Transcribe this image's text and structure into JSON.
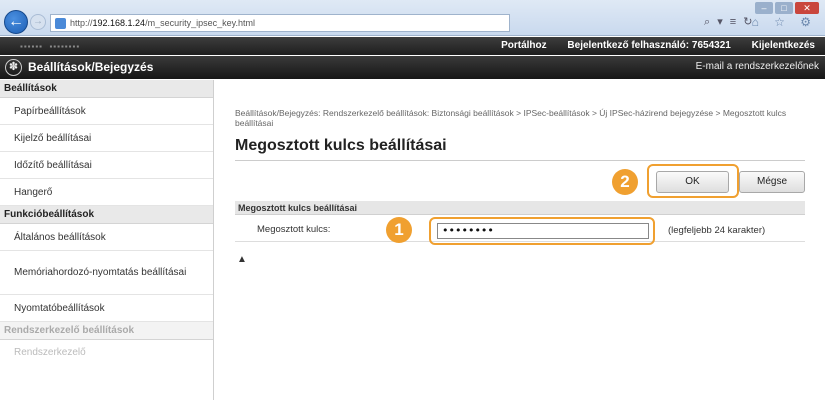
{
  "browser": {
    "url_prefix": "http://",
    "url_host": "192.168.1.24",
    "url_path": "/m_security_ipsec_key.html",
    "addr_tools": "⌕ ▾ ≡ ↻",
    "toolbar_icons": "⌂ ☆ ⚙",
    "window_controls": [
      "–",
      "□",
      "✕"
    ]
  },
  "header": {
    "links": [
      "Portálhoz",
      "Bejelentkező felhasználó: 7654321",
      "Kijelentkezés"
    ],
    "title": "Beállítások/Bejegyzés",
    "mail_link": "E-mail a rendszerkezelőnek"
  },
  "sidebar": {
    "section1": "Beállítások",
    "items1": [
      "Papírbeállítások",
      "Kijelző beállításai",
      "Időzítő beállításai",
      "Hangerő"
    ],
    "section2": "Funkcióbeállítások",
    "items2": [
      "Általános beállítások",
      "Memóriahordozó-nyomtatás beállításai",
      "Nyomtatóbeállítások"
    ],
    "section3": "Rendszerkezelő beállítások",
    "items3": [
      "Rendszerkezelő"
    ]
  },
  "main": {
    "breadcrumb": "Beállítások/Bejegyzés: Rendszerkezelő beállítások: Biztonsági beállítások > IPSec-beállítások > Új IPSec-házirend bejegyzése > Megosztott kulcs beállításai",
    "title": "Megosztott kulcs beállításai",
    "ok_label": "OK",
    "cancel_label": "Mégse",
    "section_title": "Megosztott kulcs beállításai",
    "field_label": "Megosztott kulcs:",
    "field_value": "••••••••",
    "field_hint": "(legfeljebb 24 karakter)",
    "top_link": "▲"
  },
  "callouts": [
    "1",
    "2"
  ],
  "colors": {
    "callout": "#f0a030",
    "header_bg": "#1e1e1e",
    "back_button": "#1d5fb5"
  }
}
